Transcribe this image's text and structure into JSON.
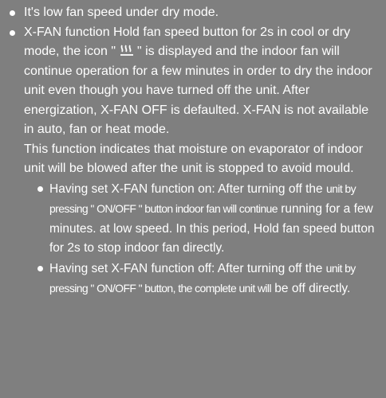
{
  "bullets": [
    {
      "text": "It's low fan speed under dry mode."
    },
    {
      "intro_before_icon": "X-FAN function Hold fan speed button for 2s in cool or dry mode, the icon \"",
      "icon": "x-fan-icon",
      "intro_after_icon": "\" is displayed and the indoor fan will continue operation for a few minutes in order to dry the indoor unit even though you have turned off the unit. After energization, X-FAN OFF is defaulted. X-FAN is not available in auto, fan or heat mode.",
      "note": "This function indicates that moisture on evaporator of indoor unit will be blowed after the unit is stopped to avoid mould.",
      "subitems": [
        {
          "lead": "Having set X-FAN function on: After turning off the",
          "narrow": "unit by pressing \" ON/OFF \" button indoor fan will continue",
          "rest": "running for a few minutes. at low speed. In this period, Hold fan speed button for 2s to stop indoor fan directly."
        },
        {
          "lead": "Having set X-FAN function off: After turning off the",
          "narrow": "unit by pressing \" ON/OFF \" button, the complete unit will",
          "rest": "be off directly."
        }
      ]
    }
  ]
}
